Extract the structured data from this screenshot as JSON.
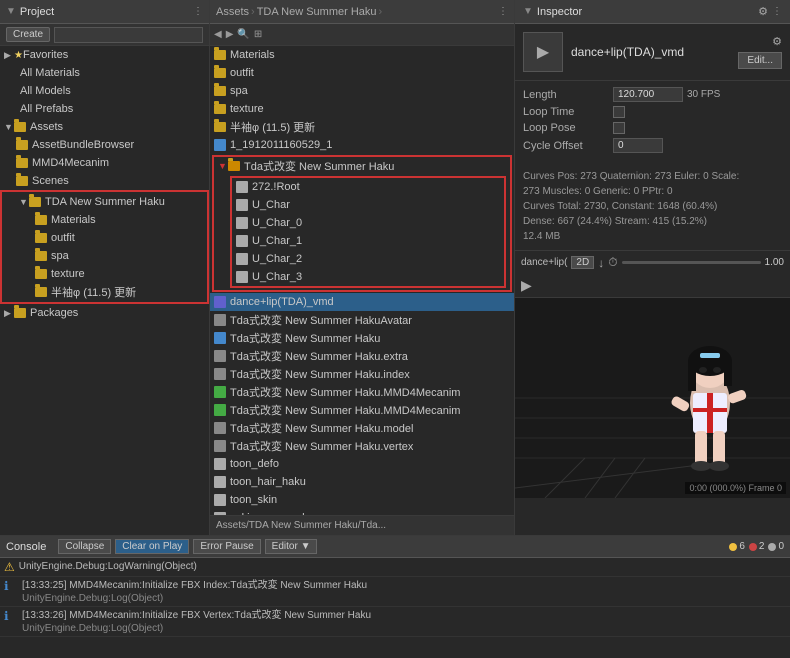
{
  "project_panel": {
    "title": "Project",
    "create_label": "Create",
    "favorites": {
      "label": "Favorites",
      "items": [
        "All Materials",
        "All Models",
        "All Prefabs"
      ]
    },
    "assets": {
      "label": "Assets",
      "items": [
        "AssetBundleBrowser",
        "MMD4Mecanim",
        "Scenes",
        "TDA New Summer Haku"
      ],
      "tda_children": [
        "Materials",
        "outfit",
        "spa",
        "texture",
        "半袖φ (11.5) 更新"
      ]
    },
    "packages": {
      "label": "Packages"
    }
  },
  "assets_panel": {
    "breadcrumb": [
      "Assets",
      "TDA New Summer Haku"
    ],
    "items": [
      {
        "label": "Materials",
        "type": "folder"
      },
      {
        "label": "outfit",
        "type": "folder"
      },
      {
        "label": "spa",
        "type": "folder"
      },
      {
        "label": "texture",
        "type": "folder"
      },
      {
        "label": "半袖φ (11.5) 更新",
        "type": "folder"
      },
      {
        "label": "1_1912011160529_1",
        "type": "file"
      },
      {
        "label": "Tda式改変 New Summer Haku",
        "type": "folder"
      },
      {
        "label": "Tda式改変 New Summer Haku",
        "type": "folder_open",
        "outlined": true
      },
      {
        "label": "272.!Root",
        "type": "sub_file",
        "indent": 1
      },
      {
        "label": "U_Char",
        "type": "sub_file",
        "indent": 1
      },
      {
        "label": "U_Char_0",
        "type": "sub_file",
        "indent": 1
      },
      {
        "label": "U_Char_1",
        "type": "sub_file",
        "indent": 1
      },
      {
        "label": "U_Char_2",
        "type": "sub_file",
        "indent": 1
      },
      {
        "label": "U_Char_3",
        "type": "sub_file",
        "indent": 1
      },
      {
        "label": "dance+lip(TDA)_vmd",
        "type": "vmd",
        "selected": true
      },
      {
        "label": "Tda式改変 New Summer HakuAvatar",
        "type": "file"
      },
      {
        "label": "Tda式改変 New Summer Haku",
        "type": "file"
      },
      {
        "label": "Tda式改変 New Summer Haku.extra",
        "type": "file"
      },
      {
        "label": "Tda式改変 New Summer Haku.index",
        "type": "file"
      },
      {
        "label": "Tda式改変 New Summer Haku.MMD4Mecanim",
        "type": "file"
      },
      {
        "label": "Tda式改変 New Summer Haku.MMD4Mecanim",
        "type": "file"
      },
      {
        "label": "Tda式改変 New Summer Haku.model",
        "type": "file"
      },
      {
        "label": "Tda式改変 New Summer Haku.vertex",
        "type": "file"
      },
      {
        "label": "toon_defo",
        "type": "file"
      },
      {
        "label": "toon_hair_haku",
        "type": "file"
      },
      {
        "label": "toon_skin",
        "type": "file"
      },
      {
        "label": "yukiyame_readme",
        "type": "file"
      }
    ],
    "status_bar": "Assets/TDA New Summer Haku/Tda..."
  },
  "inspector_panel": {
    "title": "Inspector",
    "file_name": "dance+lip(TDA)_vmd",
    "edit_label": "Edit...",
    "props": {
      "length_label": "Length",
      "length_value": "120.700",
      "fps_value": "30 FPS",
      "loop_time_label": "Loop Time",
      "loop_pose_label": "Loop Pose",
      "cycle_offset_label": "Cycle Offset",
      "cycle_offset_value": "0"
    },
    "info_text": "Curves Pos: 273 Quaternion: 273 Euler: 0 Scale:\n273 Muscles: 0 Generic: 0 PPtr: 0\nCurves Total: 2730, Constant: 1648 (60.4%)\nDense: 667 (24.4%) Stream: 415 (15.2%)\n12.4 MB",
    "timeline": {
      "label": "dance+lip(",
      "mode": "2D",
      "value": "1.00"
    },
    "frame_info": "0:00 (000.0%) Frame 0"
  },
  "console_panel": {
    "title": "Console",
    "buttons": [
      "Collapse",
      "Clear on Play",
      "Error Pause",
      "Editor"
    ],
    "badges": [
      {
        "count": "6",
        "type": "warn"
      },
      {
        "count": "2",
        "type": "error"
      },
      {
        "count": "0",
        "type": "info"
      }
    ],
    "items": [
      {
        "type": "warn",
        "text": "UnityEngine.Debug:LogWarning(Object)"
      },
      {
        "type": "info",
        "text": "[13:33:25] MMD4Mecanim:Initialize FBX Index:Tda式改変 New Summer Haku",
        "sub": "UnityEngine.Debug:Log(Object)"
      },
      {
        "type": "info",
        "text": "[13:33:26] MMD4Mecanim:Initialize FBX Vertex:Tda式改変 New Summer Haku",
        "sub": "UnityEngine.Debug:Log(Object)"
      }
    ]
  }
}
